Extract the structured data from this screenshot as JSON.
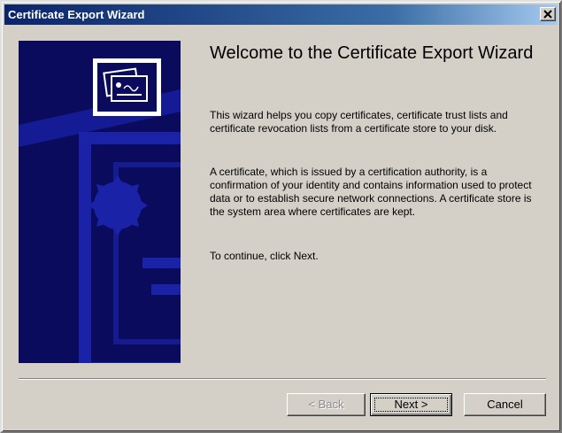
{
  "window": {
    "title": "Certificate Export Wizard",
    "close_label": "×"
  },
  "content": {
    "heading": "Welcome to the Certificate Export Wizard",
    "paragraph1": "This wizard helps you copy certificates, certificate trust lists and certificate revocation lists from a certificate store to your disk.",
    "paragraph2": "A certificate, which is issued by a certification authority, is a confirmation of your identity and contains information used to protect data or to establish secure network connections. A certificate store is the system area where certificates are kept.",
    "paragraph3": "To continue, click Next."
  },
  "buttons": {
    "back": "< Back",
    "next": "Next >",
    "cancel": "Cancel"
  },
  "colors": {
    "titlebar": "#0a246a",
    "side_panel": "#0b0b5e",
    "face": "#d4d0c8"
  }
}
